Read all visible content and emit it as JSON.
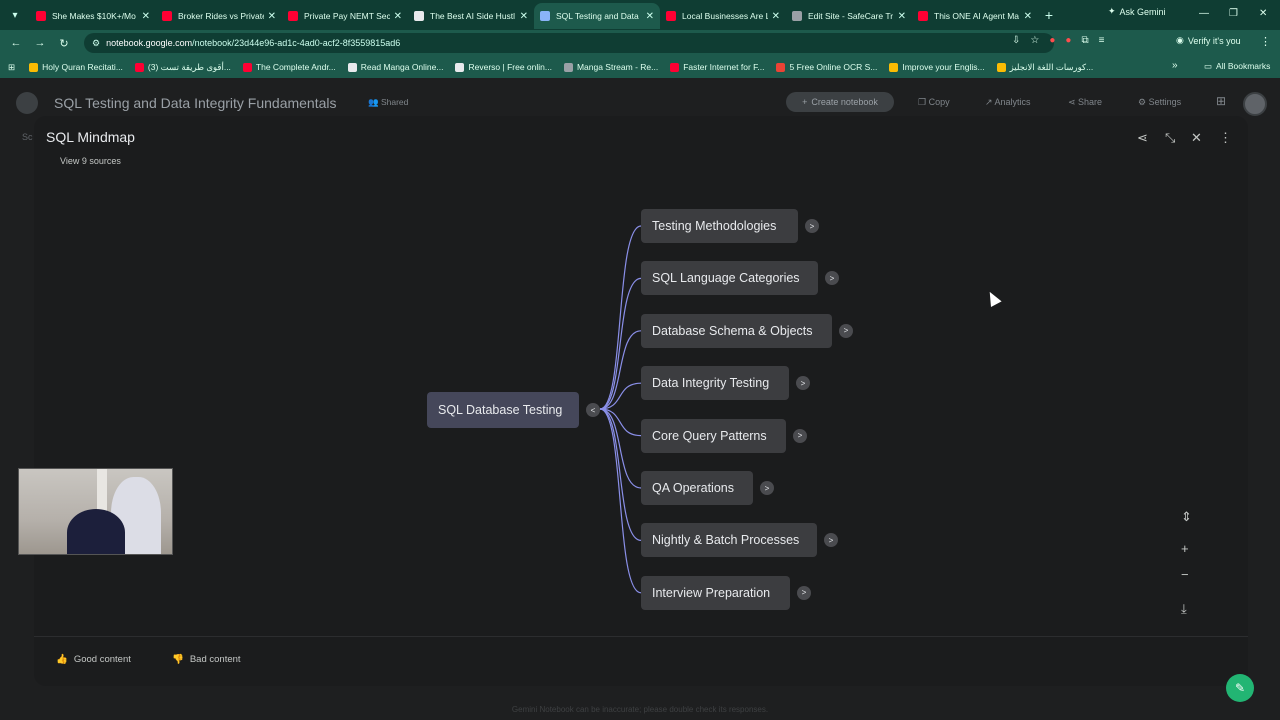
{
  "browser": {
    "tabs": [
      {
        "title": "She Makes $10K+/Mo",
        "favicon_color": "#ff0033"
      },
      {
        "title": "Broker Rides vs Private",
        "favicon_color": "#ff0033"
      },
      {
        "title": "Private Pay NEMT Sec",
        "favicon_color": "#ff0033"
      },
      {
        "title": "The Best AI Side Hustl",
        "favicon_color": "#e8eaed"
      },
      {
        "title": "SQL Testing and Data",
        "favicon_color": "#8ab4f8",
        "active": true
      },
      {
        "title": "Local Businesses Are L",
        "favicon_color": "#ff0033"
      },
      {
        "title": "Edit Site - SafeCare Tr",
        "favicon_color": "#9aa0a6"
      },
      {
        "title": "This ONE AI Agent Ma",
        "favicon_color": "#ff0033"
      }
    ],
    "new_tab": "+",
    "ask_gemini": "Ask Gemini",
    "url_host": "notebook.google.com",
    "url_path": "/notebook/23d44e96-ad1c-4ad0-acf2-8f3559815ad6",
    "verify_label": "Verify it's you",
    "bookmarks": [
      {
        "label": "Holy Quran Recitati...",
        "color": "#fbbc04"
      },
      {
        "label": "(3) أقوى طريقة تست...",
        "color": "#ff0033"
      },
      {
        "label": "The Complete Andr...",
        "color": "#ff0033"
      },
      {
        "label": "Read Manga Online...",
        "color": "#e8eaed"
      },
      {
        "label": "Reverso | Free onlin...",
        "color": "#e8eaed"
      },
      {
        "label": "Manga Stream - Re...",
        "color": "#9aa0a6"
      },
      {
        "label": "Faster Internet for F...",
        "color": "#ff0033"
      },
      {
        "label": "5 Free Online OCR S...",
        "color": "#ea4335"
      },
      {
        "label": "Improve your Englis...",
        "color": "#fbbc04"
      },
      {
        "label": "كورسات اللغة الانجليز...",
        "color": "#fbbc04"
      }
    ],
    "all_bookmarks": "All Bookmarks"
  },
  "notebook": {
    "title": "SQL Testing and Data Integrity Fundamentals",
    "shared": "Shared",
    "create_label": "Create notebook",
    "copy_label": "Copy",
    "analytics_label": "Analytics",
    "share_label": "Share",
    "settings_label": "Settings",
    "side_peek": "Sc"
  },
  "mindmap": {
    "title": "SQL Mindmap",
    "view_sources": "View 9 sources",
    "root": "SQL Database Testing",
    "root_toggle": "<",
    "child_toggle": ">",
    "children": [
      "Testing Methodologies",
      "SQL Language Categories",
      "Database Schema & Objects",
      "Data Integrity Testing",
      "Core Query Patterns",
      "QA Operations",
      "Nightly & Batch Processes",
      "Interview Preparation"
    ],
    "good_content": "Good content",
    "bad_content": "Bad content"
  },
  "footer": {
    "disclaimer": "Gemini Notebook can be inaccurate; please double check its responses."
  },
  "colors": {
    "tab_bar": "#0f3d33",
    "toolbar": "#1d5a4c",
    "node": "#3c3d40",
    "root_node": "#45475a",
    "connector": "#8a8fe8"
  }
}
